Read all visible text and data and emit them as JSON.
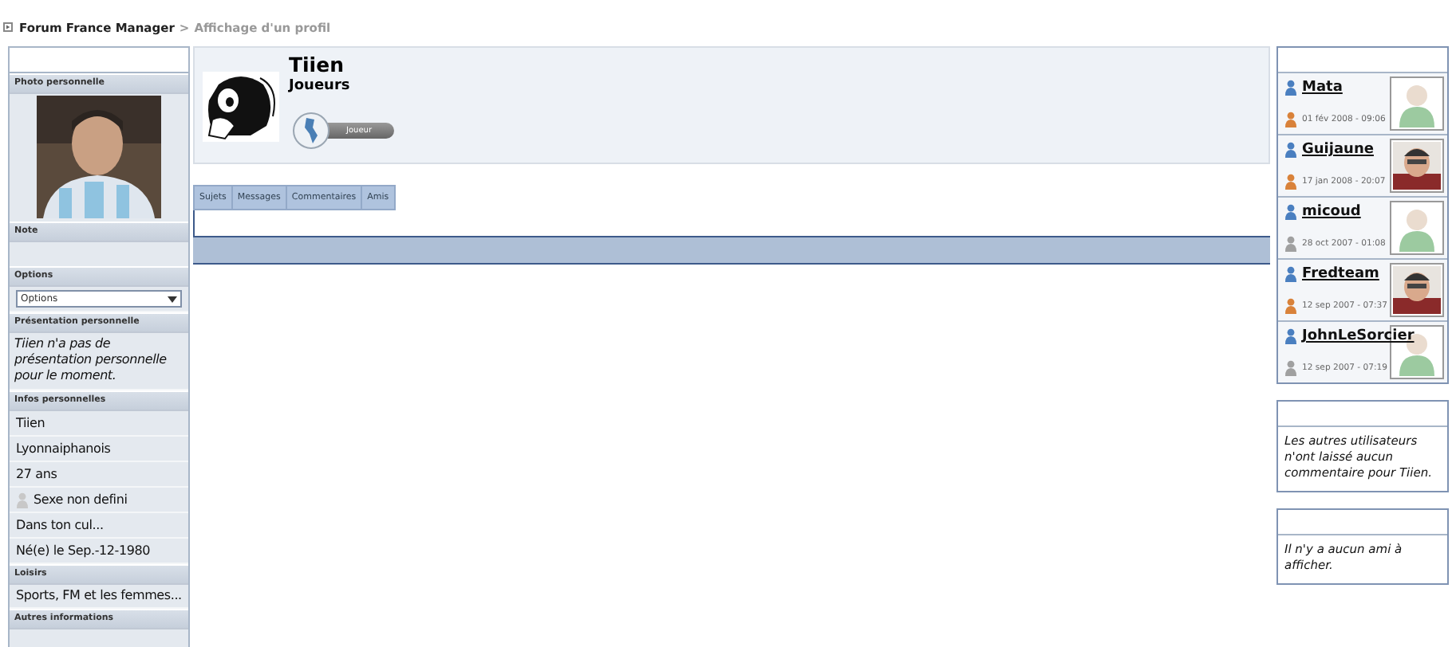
{
  "breadcrumb": {
    "home": "Forum France Manager",
    "separator": ">",
    "current": "Affichage d'un profil"
  },
  "sidebar": {
    "sections": [
      {
        "title": "Photo personnelle"
      },
      {
        "title": "Note",
        "kind": "empty"
      },
      {
        "title": "Options",
        "kind": "select",
        "value": "Options"
      },
      {
        "title": "Présentation personnelle",
        "kind": "italic",
        "text": "Tiien n'a pas de présentation personnelle pour le moment."
      },
      {
        "title": "Infos personnelles",
        "kind": "list",
        "items": [
          {
            "text": "Tiien"
          },
          {
            "text": "Lyonnaiphanois"
          },
          {
            "text": "27 ans"
          },
          {
            "text": "Sexe non defini",
            "kind": "gender"
          },
          {
            "text": "Dans ton cul..."
          },
          {
            "text": "Né(e) le Sep.-12-1980"
          }
        ]
      },
      {
        "title": "Loisirs",
        "kind": "text",
        "text": "Sports, FM et les femmes..."
      },
      {
        "title": "Autres informations",
        "kind": "empty"
      }
    ]
  },
  "profile": {
    "username": "Tiien",
    "group": "Joueurs",
    "rank": "Joueur"
  },
  "tabs": [
    {
      "label": "Sujets",
      "selected": false
    },
    {
      "label": "Messages",
      "selected": false
    },
    {
      "label": "Commentaires",
      "selected": false
    },
    {
      "label": "Amis",
      "selected": false
    }
  ],
  "visitors": [
    {
      "name": "Mata",
      "date": "01 fév 2008 - 09:06",
      "color": "#d9823a",
      "kind": "default"
    },
    {
      "name": "Guijaune",
      "date": "17 jan 2008 - 20:07",
      "color": "#d9823a",
      "kind": "picture"
    },
    {
      "name": "micoud",
      "date": "28 oct 2007 - 01:08",
      "color": "#a0a0a0",
      "kind": "default"
    },
    {
      "name": "Fredteam",
      "date": "12 sep 2007 - 07:37",
      "color": "#d9823a",
      "kind": "picture"
    },
    {
      "name": "JohnLeSorcier",
      "date": "12 sep 2007 - 07:19",
      "color": "#a0a0a0",
      "kind": "default"
    }
  ],
  "comments": {
    "message": "Les autres utilisateurs n'ont laissé aucun commentaire pour Tiien."
  },
  "friends": {
    "message": "Il n'y a aucun ami à afficher."
  }
}
